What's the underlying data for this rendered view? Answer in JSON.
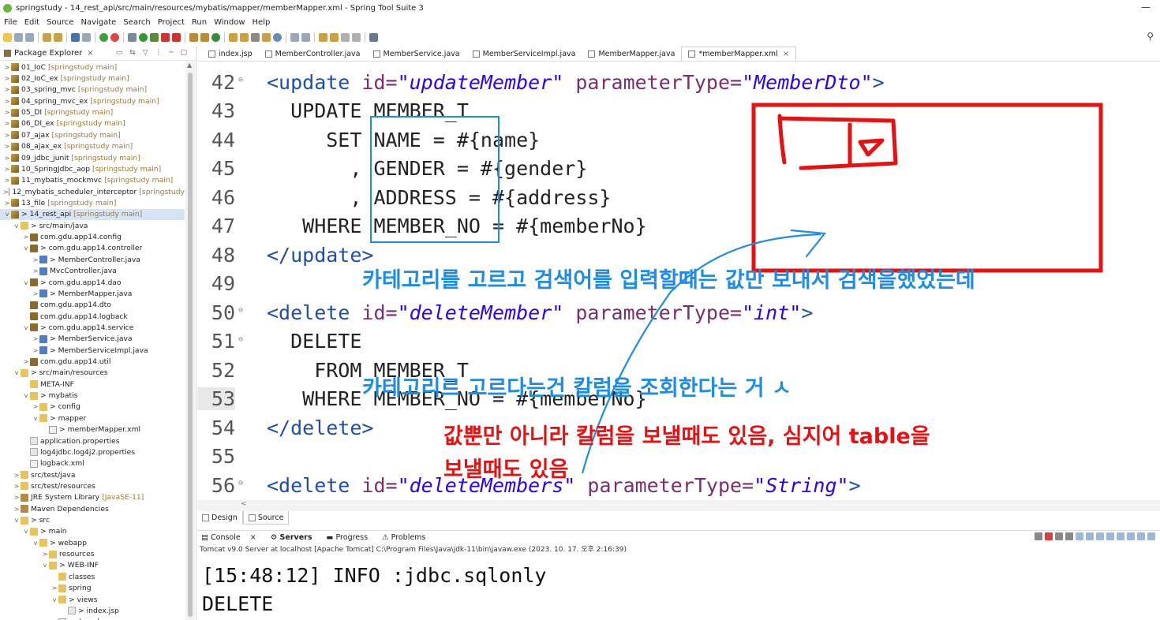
{
  "window": {
    "title": "springstudy - 14_rest_api/src/main/resources/mybatis/mapper/memberMapper.xml - Spring Tool Suite 3",
    "minimize": "—"
  },
  "menu": [
    "File",
    "Edit",
    "Source",
    "Navigate",
    "Search",
    "Project",
    "Run",
    "Window",
    "Help"
  ],
  "explorer": {
    "title": "Package Explorer",
    "close": "×",
    "tree": [
      {
        "arrow": ">",
        "icon": "project",
        "label": "01_IoC",
        "deco": "[springstudy main]"
      },
      {
        "arrow": ">",
        "icon": "project",
        "label": "02_IoC_ex",
        "deco": "[springstudy main]"
      },
      {
        "arrow": ">",
        "icon": "project",
        "label": "03_spring_mvc",
        "deco": "[springstudy main]"
      },
      {
        "arrow": ">",
        "icon": "project",
        "label": "04_spring_mvc_ex",
        "deco": "[springstudy main]"
      },
      {
        "arrow": ">",
        "icon": "project",
        "label": "05_DI",
        "deco": "[springstudy main]"
      },
      {
        "arrow": ">",
        "icon": "project",
        "label": "06_DI_ex",
        "deco": "[springstudy main]"
      },
      {
        "arrow": ">",
        "icon": "project",
        "label": "07_ajax",
        "deco": "[springstudy main]"
      },
      {
        "arrow": ">",
        "icon": "project",
        "label": "08_ajax_ex",
        "deco": "[springstudy main]"
      },
      {
        "arrow": ">",
        "icon": "project",
        "label": "09_jdbc_junit",
        "deco": "[springstudy main]"
      },
      {
        "arrow": ">",
        "icon": "project",
        "label": "10_SpringJdbc_aop",
        "deco": "[springstudy main]"
      },
      {
        "arrow": ">",
        "icon": "project",
        "label": "11_mybatis_mockmvc",
        "deco": "[springstudy main]"
      },
      {
        "arrow": ">",
        "icon": "project",
        "label": "12_mybatis_scheduler_interceptor",
        "deco": "[springstudy"
      },
      {
        "arrow": ">",
        "icon": "project",
        "label": "13_file",
        "deco": "[springstudy main]"
      },
      {
        "arrow": "v",
        "icon": "project",
        "label": "> 14_rest_api",
        "deco": "[springstudy main]",
        "selected": true
      },
      {
        "arrow": "v",
        "icon": "folder",
        "label": "> src/main/java",
        "deco": "",
        "indent": 1
      },
      {
        "arrow": ">",
        "icon": "package",
        "label": "com.gdu.app14.config",
        "deco": "",
        "indent": 2
      },
      {
        "arrow": "v",
        "icon": "package",
        "label": "> com.gdu.app14.controller",
        "deco": "",
        "indent": 2
      },
      {
        "arrow": ">",
        "icon": "java",
        "label": "> MemberController.java",
        "deco": "",
        "indent": 3
      },
      {
        "arrow": ">",
        "icon": "java",
        "label": "MvcController.java",
        "deco": "",
        "indent": 3
      },
      {
        "arrow": "v",
        "icon": "package",
        "label": "> com.gdu.app14.dao",
        "deco": "",
        "indent": 2
      },
      {
        "arrow": ">",
        "icon": "java",
        "label": "> MemberMapper.java",
        "deco": "",
        "indent": 3
      },
      {
        "arrow": "",
        "icon": "package",
        "label": "com.gdu.app14.dto",
        "deco": "",
        "indent": 2
      },
      {
        "arrow": "",
        "icon": "package",
        "label": "com.gdu.app14.logback",
        "deco": "",
        "indent": 2
      },
      {
        "arrow": "v",
        "icon": "package",
        "label": "> com.gdu.app14.service",
        "deco": "",
        "indent": 2
      },
      {
        "arrow": ">",
        "icon": "java",
        "label": "> MemberService.java",
        "deco": "",
        "indent": 3
      },
      {
        "arrow": ">",
        "icon": "java",
        "label": "> MemberServiceImpl.java",
        "deco": "",
        "indent": 3
      },
      {
        "arrow": ">",
        "icon": "package",
        "label": "com.gdu.app14.util",
        "deco": "",
        "indent": 2
      },
      {
        "arrow": "v",
        "icon": "folder",
        "label": "> src/main/resources",
        "deco": "",
        "indent": 1
      },
      {
        "arrow": "",
        "icon": "folder",
        "label": "META-INF",
        "deco": "",
        "indent": 2
      },
      {
        "arrow": "v",
        "icon": "folder",
        "label": "> mybatis",
        "deco": "",
        "indent": 2
      },
      {
        "arrow": ">",
        "icon": "folder",
        "label": "> config",
        "deco": "",
        "indent": 3
      },
      {
        "arrow": "v",
        "icon": "folder",
        "label": "> mapper",
        "deco": "",
        "indent": 3
      },
      {
        "arrow": "",
        "icon": "xml",
        "label": "> memberMapper.xml",
        "deco": "",
        "indent": 4
      },
      {
        "arrow": "",
        "icon": "file",
        "label": "application.properties",
        "deco": "",
        "indent": 2
      },
      {
        "arrow": "",
        "icon": "file",
        "label": "log4jdbc.log4j2.properties",
        "deco": "",
        "indent": 2
      },
      {
        "arrow": "",
        "icon": "xml",
        "label": "logback.xml",
        "deco": "",
        "indent": 2
      },
      {
        "arrow": ">",
        "icon": "folder",
        "label": "src/test/java",
        "deco": "",
        "indent": 1
      },
      {
        "arrow": ">",
        "icon": "folder",
        "label": "src/test/resources",
        "deco": "",
        "indent": 1
      },
      {
        "arrow": ">",
        "icon": "lib",
        "label": "JRE System Library",
        "deco": "[JavaSE-11]",
        "indent": 1
      },
      {
        "arrow": ">",
        "icon": "lib",
        "label": "Maven Dependencies",
        "deco": "",
        "indent": 1
      },
      {
        "arrow": "v",
        "icon": "folder",
        "label": "> src",
        "deco": "",
        "indent": 1
      },
      {
        "arrow": "v",
        "icon": "folder",
        "label": "> main",
        "deco": "",
        "indent": 2
      },
      {
        "arrow": "v",
        "icon": "folder",
        "label": "> webapp",
        "deco": "",
        "indent": 3
      },
      {
        "arrow": ">",
        "icon": "folder",
        "label": "resources",
        "deco": "",
        "indent": 4
      },
      {
        "arrow": "v",
        "icon": "folder",
        "label": "> WEB-INF",
        "deco": "",
        "indent": 4
      },
      {
        "arrow": "",
        "icon": "folder",
        "label": "classes",
        "deco": "",
        "indent": 5
      },
      {
        "arrow": ">",
        "icon": "folder",
        "label": "spring",
        "deco": "",
        "indent": 5
      },
      {
        "arrow": "v",
        "icon": "folder",
        "label": "> views",
        "deco": "",
        "indent": 5
      },
      {
        "arrow": "",
        "icon": "file",
        "label": "> index.jsp",
        "deco": "",
        "indent": 6
      },
      {
        "arrow": "",
        "icon": "xml",
        "label": "web.xml",
        "deco": "",
        "indent": 5
      }
    ]
  },
  "editor_tabs": [
    {
      "label": "index.jsp"
    },
    {
      "label": "MemberController.java"
    },
    {
      "label": "MemberService.java"
    },
    {
      "label": "MemberServiceImpl.java"
    },
    {
      "label": "MemberMapper.java"
    },
    {
      "label": "*memberMapper.xml",
      "active": true
    }
  ],
  "code": [
    {
      "num": "42",
      "fold": "⊖",
      "parts": [
        [
          "t",
          "<update "
        ],
        [
          "a",
          "id="
        ],
        [
          "v",
          "\"updateMember\""
        ],
        [
          "t",
          " "
        ],
        [
          "a",
          "parameterType="
        ],
        [
          "v",
          "\"MemberDto\""
        ],
        [
          "t",
          ">"
        ]
      ]
    },
    {
      "num": "43",
      "fold": "",
      "parts": [
        [
          "p",
          "  UPDATE MEMBER_T"
        ]
      ]
    },
    {
      "num": "44",
      "fold": "",
      "parts": [
        [
          "p",
          "     SET NAME = #{name}"
        ]
      ]
    },
    {
      "num": "45",
      "fold": "",
      "parts": [
        [
          "p",
          "       , GENDER = #{gender}"
        ]
      ]
    },
    {
      "num": "46",
      "fold": "",
      "parts": [
        [
          "p",
          "       , ADDRESS = #{address}"
        ]
      ]
    },
    {
      "num": "47",
      "fold": "",
      "parts": [
        [
          "p",
          "   WHERE MEMBER_NO = #{memberNo}"
        ]
      ]
    },
    {
      "num": "48",
      "fold": "",
      "parts": [
        [
          "t",
          "</update>"
        ]
      ]
    },
    {
      "num": "49",
      "fold": "",
      "parts": []
    },
    {
      "num": "50",
      "fold": "⊖",
      "parts": [
        [
          "t",
          "<delete "
        ],
        [
          "a",
          "id="
        ],
        [
          "v",
          "\"deleteMember\""
        ],
        [
          "t",
          " "
        ],
        [
          "a",
          "parameterType="
        ],
        [
          "v",
          "\"int\""
        ],
        [
          "t",
          ">"
        ]
      ]
    },
    {
      "num": "51",
      "fold": "⊖",
      "parts": [
        [
          "p",
          "  DELETE"
        ]
      ]
    },
    {
      "num": "52",
      "fold": "",
      "parts": [
        [
          "p",
          "    FROM MEMBER_T"
        ]
      ]
    },
    {
      "num": "53",
      "fold": "",
      "current": true,
      "parts": [
        [
          "p",
          "   WHERE MEMBER_NO = #{memberNo}"
        ]
      ]
    },
    {
      "num": "54",
      "fold": "",
      "parts": [
        [
          "t",
          "</delete>"
        ]
      ]
    },
    {
      "num": "55",
      "fold": "",
      "parts": []
    },
    {
      "num": "56",
      "fold": "⊖",
      "parts": [
        [
          "t",
          "<delete "
        ],
        [
          "a",
          "id="
        ],
        [
          "v",
          "\"deleteMembers\""
        ],
        [
          "t",
          " "
        ],
        [
          "a",
          "parameterType="
        ],
        [
          "v",
          "\"String\""
        ],
        [
          "t",
          ">"
        ]
      ]
    }
  ],
  "design_tabs": {
    "design": "Design",
    "source": "Source"
  },
  "console": {
    "tabs": [
      {
        "label": "Console",
        "close": "×"
      },
      {
        "label": "Servers",
        "bold": true
      },
      {
        "label": "Progress"
      },
      {
        "label": "Problems"
      }
    ],
    "info": "Tomcat v9.0 Server at localhost [Apache Tomcat] C:\\Program Files\\Java\\jdk-11\\bin\\javaw.exe  (2023. 10. 17. 오후 2:16:39)",
    "output": [
      "[15:48:12] INFO :jdbc.sqlonly",
      "DELETE"
    ]
  },
  "annotations": {
    "line1": "카테고리를 고르고 검색어를 입력할때는 값만 보내서 검색을했었는데",
    "line2": "카테고리르 고르다는건 칼럼을 조회한다는 거 ㅅ",
    "line3": "값뿐만 아니라 칼럼을 보낼때도 있음, 심지어 table을",
    "line4": "보낼때도 있음",
    "blue": "#1d8ce8",
    "red": "#e81010"
  }
}
